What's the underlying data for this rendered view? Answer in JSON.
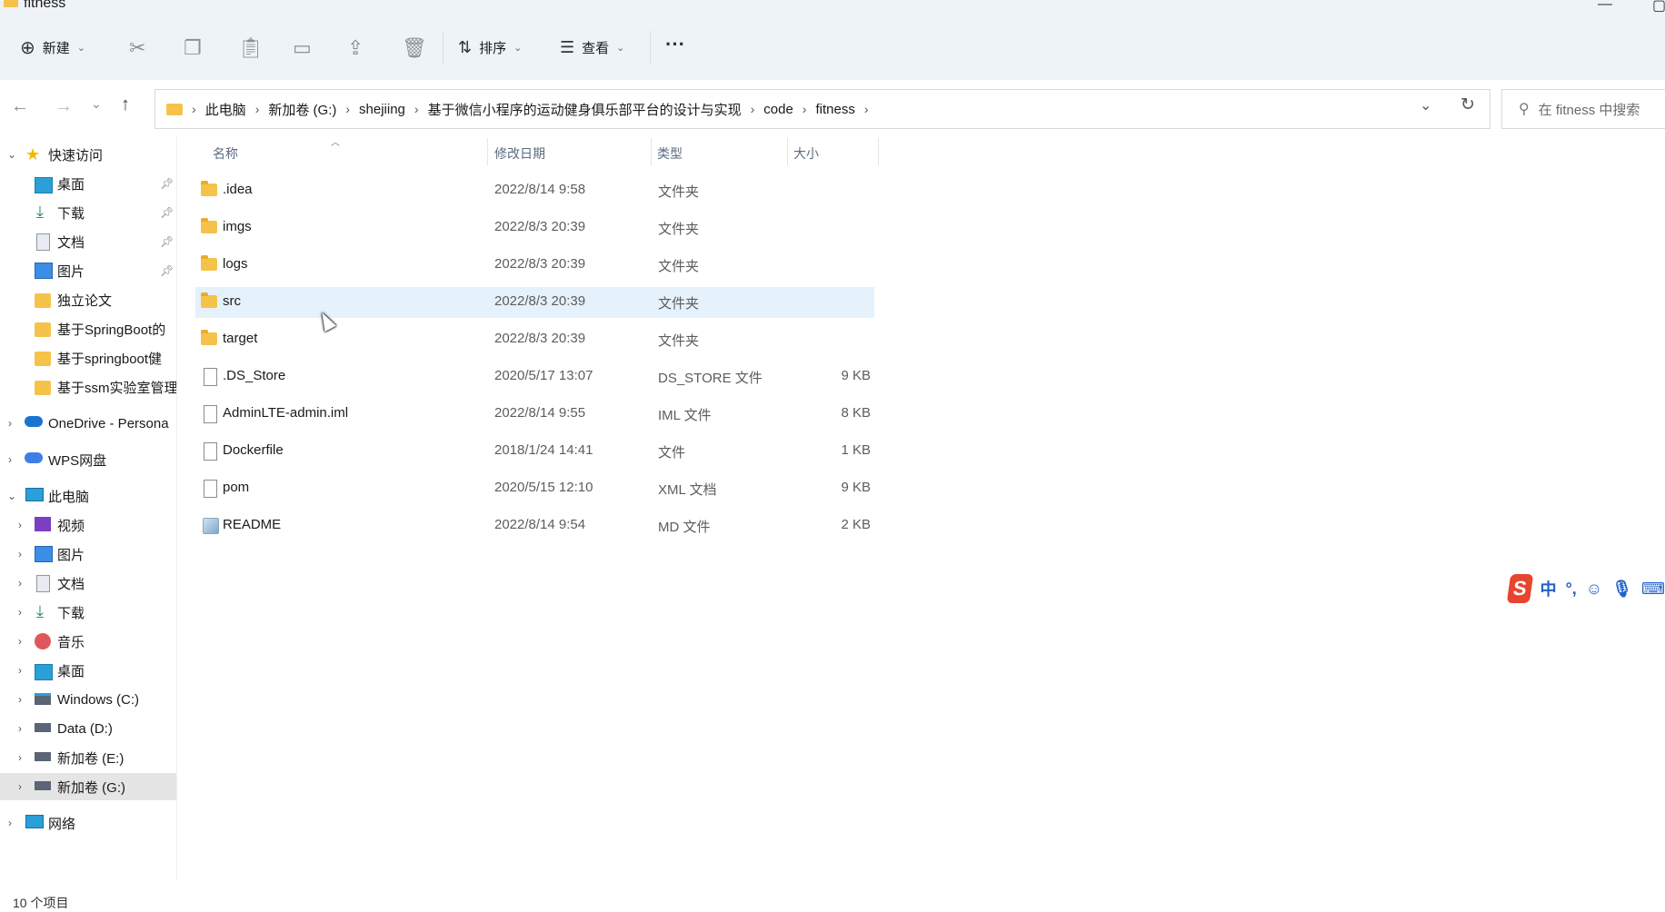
{
  "window": {
    "title": "fitness"
  },
  "toolbar": {
    "new_label": "新建",
    "sort_label": "排序",
    "view_label": "查看",
    "more_label": "···"
  },
  "address": {
    "crumbs": [
      "此电脑",
      "新加卷 (G:)",
      "shejiing",
      "基于微信小程序的运动健身俱乐部平台的设计与实现",
      "code",
      "fitness"
    ],
    "search_placeholder": "在 fitness 中搜索"
  },
  "sidebar": {
    "quick_access": "快速访问",
    "items": [
      {
        "label": "桌面"
      },
      {
        "label": "下载"
      },
      {
        "label": "文档"
      },
      {
        "label": "图片"
      },
      {
        "label": "独立论文"
      },
      {
        "label": "基于SpringBoot的"
      },
      {
        "label": "基于springboot健"
      },
      {
        "label": "基于ssm实验室管理"
      }
    ],
    "onedrive": "OneDrive - Persona",
    "wps": "WPS网盘",
    "this_pc": "此电脑",
    "pc_items": [
      {
        "label": "视频"
      },
      {
        "label": "图片"
      },
      {
        "label": "文档"
      },
      {
        "label": "下载"
      },
      {
        "label": "音乐"
      },
      {
        "label": "桌面"
      },
      {
        "label": "Windows (C:)"
      },
      {
        "label": "Data (D:)"
      },
      {
        "label": "新加卷 (E:)"
      },
      {
        "label": "新加卷 (G:)"
      }
    ],
    "network": "网络"
  },
  "columns": {
    "name": "名称",
    "date": "修改日期",
    "type": "类型",
    "size": "大小"
  },
  "files": [
    {
      "name": ".idea",
      "date": "2022/8/14 9:58",
      "type": "文件夹",
      "size": "",
      "kind": "folder"
    },
    {
      "name": "imgs",
      "date": "2022/8/3 20:39",
      "type": "文件夹",
      "size": "",
      "kind": "folder"
    },
    {
      "name": "logs",
      "date": "2022/8/3 20:39",
      "type": "文件夹",
      "size": "",
      "kind": "folder"
    },
    {
      "name": "src",
      "date": "2022/8/3 20:39",
      "type": "文件夹",
      "size": "",
      "kind": "folder"
    },
    {
      "name": "target",
      "date": "2022/8/3 20:39",
      "type": "文件夹",
      "size": "",
      "kind": "folder"
    },
    {
      "name": ".DS_Store",
      "date": "2020/5/17 13:07",
      "type": "DS_STORE 文件",
      "size": "9 KB",
      "kind": "file"
    },
    {
      "name": "AdminLTE-admin.iml",
      "date": "2022/8/14 9:55",
      "type": "IML 文件",
      "size": "8 KB",
      "kind": "file"
    },
    {
      "name": "Dockerfile",
      "date": "2018/1/24 14:41",
      "type": "文件",
      "size": "1 KB",
      "kind": "file"
    },
    {
      "name": "pom",
      "date": "2020/5/15 12:10",
      "type": "XML 文档",
      "size": "9 KB",
      "kind": "file"
    },
    {
      "name": "README",
      "date": "2022/8/14 9:54",
      "type": "MD 文件",
      "size": "2 KB",
      "kind": "md"
    }
  ],
  "status": {
    "count_text": "10 个项目"
  },
  "ime": {
    "lang": "中",
    "punct": "°,",
    "logo": "S"
  },
  "colors": {
    "selected_row": "#e5f1fb",
    "folder": "#f5c34a",
    "ime_logo": "#e8442e",
    "ime_icons": "#2060c8"
  }
}
